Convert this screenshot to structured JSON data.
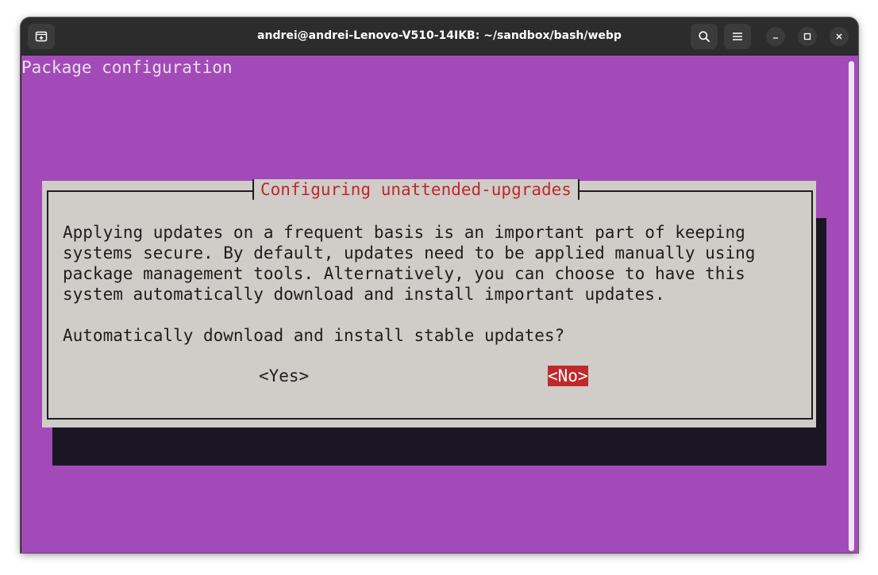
{
  "window": {
    "title": "andrei@andrei-Lenovo-V510-14IKB: ~/sandbox/bash/webp",
    "buttons": [
      "new-tab-icon",
      "search-icon",
      "menu-icon",
      "minimize-icon",
      "maximize-icon",
      "close-icon"
    ]
  },
  "terminal": {
    "header": "Package configuration",
    "background_color": "#a34ab9"
  },
  "dialog": {
    "title": "Configuring unattended-upgrades",
    "title_color": "#c0282b",
    "body_lines": [
      "Applying updates on a frequent basis is an important part of keeping",
      "systems secure. By default, updates need to be applied manually using",
      "package management tools. Alternatively, you can choose to have this",
      "system automatically download and install important updates."
    ],
    "question": "Automatically download and install stable updates?",
    "yes_label": "<Yes>",
    "no_label": "<No>",
    "selected": "no"
  }
}
